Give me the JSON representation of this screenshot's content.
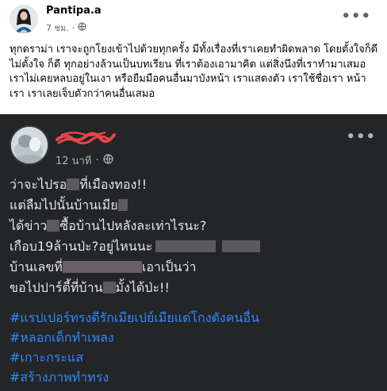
{
  "post": {
    "author": "Pantipa.a",
    "time": "7 ชม.",
    "caption": "ทุกดราม่า เราจะถูกโยงเข้าไปด้วยทุกครั้ง มีทั้งเรื่องที่เราเคยทำผิดพลาด โดยตั้งใจก็ดี ไม่ตั้งใจ ก็ดี ทุกอย่างล้วนเป็นบทเรียน ที่เราต้องเอามาคิด แต่สิ่งนึงที่เราทำมาเสมอ เราไม่เคยหลบอยู่ในเงา  หรือยืมมือคนอื่นมาบังหน้า เราแสดงตัว เราใช้ชื่อเรา หน้าเรา เราเลยเจ็บตัวกว่าคนอื่นเสมอ"
  },
  "screenshot": {
    "time": "12 นาที",
    "lines": [
      [
        "ว่าจะไปรอ",
        "ที่เมืองทอง!!"
      ],
      [
        "แต่ลืมไปนั้นบ้านเมีย",
        ""
      ],
      [
        "ได้ข่าว",
        "ซื้อบ้านไปหลังละเท่าไรนะ?"
      ],
      [
        "เกือบ19ล้านป่ะ?อยู่ไหนนะ",
        ""
      ],
      [
        "บ้านเลขที่",
        "เอาเป็นว่า"
      ],
      [
        "ขอไปปาร์ตี้ที่บ้าน",
        "มั้งได้ป่ะ!!"
      ]
    ],
    "hashtags": [
      "#แรปเปอร์ทรงดีรักเมียเปย์เมียแต่โกงตังคนอื่น",
      "#หลอกเด็กทำเพลง",
      "#เกาะกระแส",
      "#สร้างภาพทำทรง"
    ]
  },
  "colors": {
    "dark_background": "#242526",
    "hashtag_blue": "#2d88ff",
    "censor_gray": "#5b5b5d",
    "name_scribble": "#e8454a"
  }
}
